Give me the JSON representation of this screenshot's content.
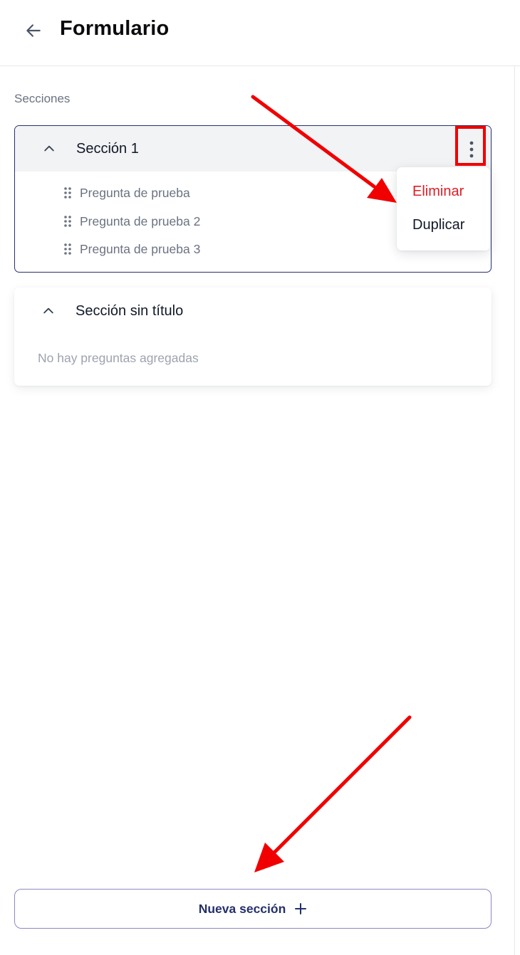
{
  "header": {
    "title": "Formulario",
    "back_icon": "arrow-left-icon"
  },
  "sections_label": "Secciones",
  "sections": [
    {
      "title": "Sección 1",
      "expanded": true,
      "questions": [
        "Pregunta de prueba",
        "Pregunta de prueba 2",
        "Pregunta de prueba 3"
      ]
    },
    {
      "title": "Sección sin título",
      "expanded": true,
      "empty_text": "No hay preguntas agregadas"
    }
  ],
  "menu": {
    "delete_label": "Eliminar",
    "duplicate_label": "Duplicar"
  },
  "new_section": {
    "label": "Nueva sección",
    "icon": "plus-icon"
  },
  "colors": {
    "accent": "#27306b",
    "danger": "#e11d26",
    "annotation": "#f00000",
    "muted_text": "#6b7280"
  }
}
